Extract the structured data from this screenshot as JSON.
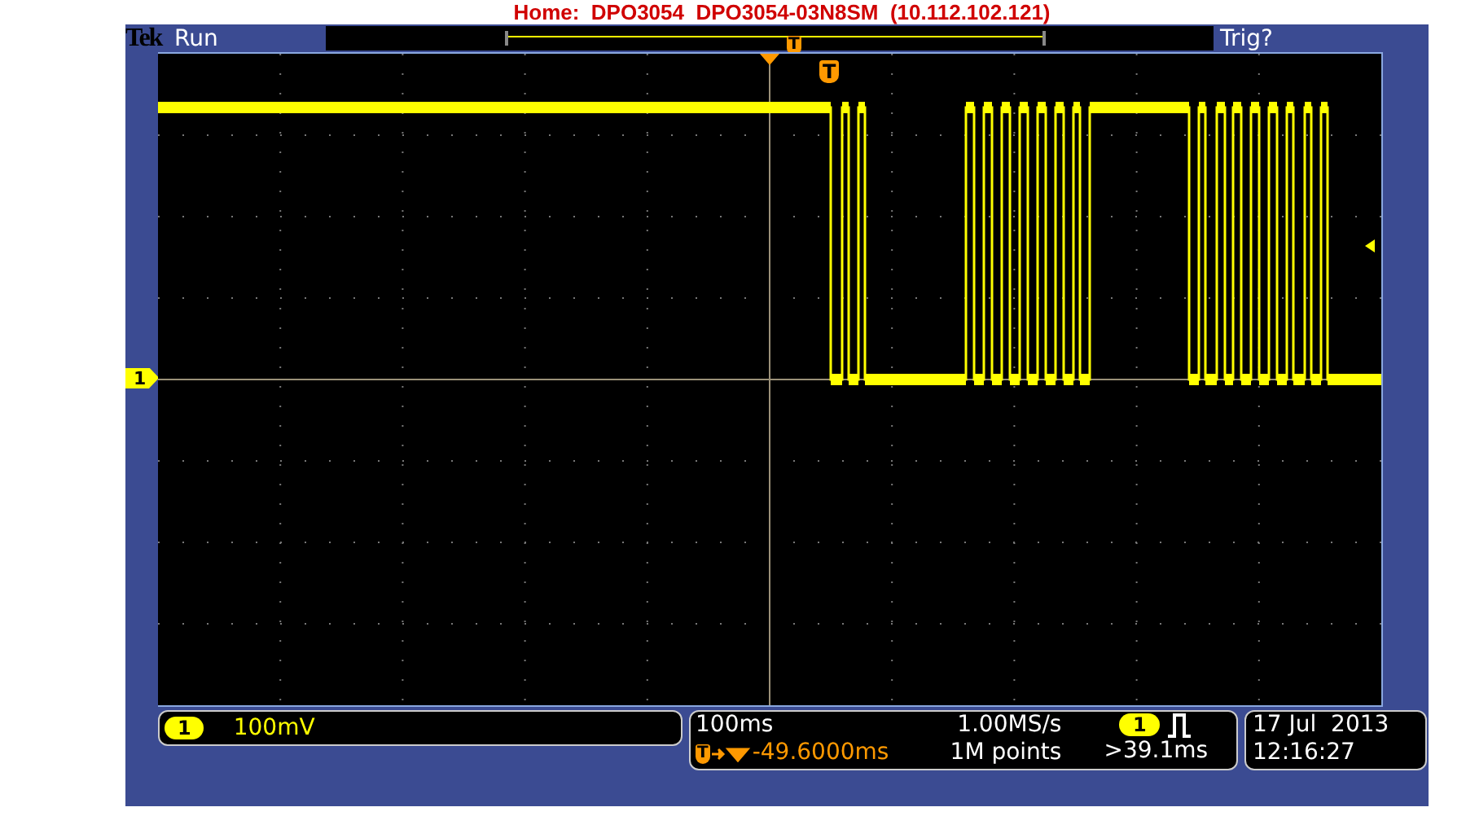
{
  "title": "Home:  DPO3054  DPO3054-03N8SM  (10.112.102.121)",
  "top_bar": {
    "brand": "Tek",
    "acquisition_status": "Run",
    "record_view": {
      "trigger_label": "T"
    },
    "trigger_status": "Trig?"
  },
  "graticule": {
    "trigger_label": "T",
    "ground_marker": "1"
  },
  "channel_readout": {
    "channel": "1",
    "scale": "100mV"
  },
  "horizontal_readout": {
    "scale": "100ms",
    "sample_rate": "1.00MS/s",
    "trigger_label": "T",
    "position": "-49.6000ms",
    "record_length": "1M points"
  },
  "trigger_readout": {
    "channel": "1",
    "condition": ">39.1ms"
  },
  "clock": {
    "date": "17 Jul  2013",
    "time": "12:16:27"
  }
}
